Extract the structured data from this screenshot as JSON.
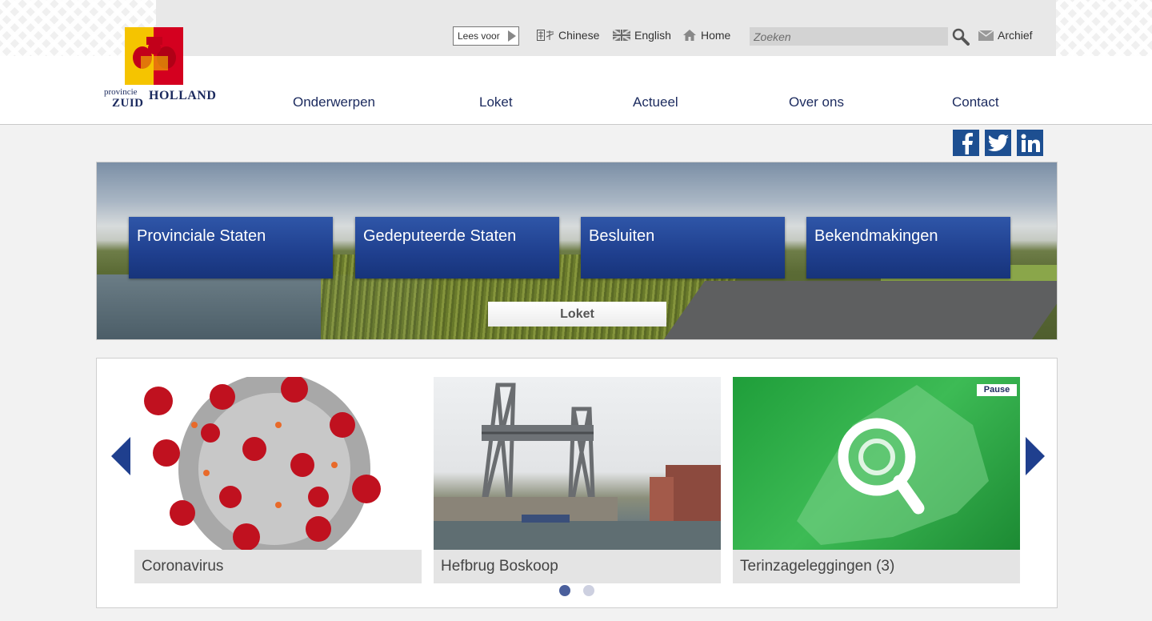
{
  "brand": {
    "line1": "provincie",
    "line2": "ZUID",
    "line3": "HOLLAND",
    "colors": {
      "navy": "#1b2a5e",
      "blue": "#1f3f8e",
      "yellow": "#f5c400",
      "red": "#d4001f"
    }
  },
  "topbar": {
    "lees_voor": "Lees voor",
    "links": [
      {
        "label": "Chinese",
        "icon": "chinese-icon"
      },
      {
        "label": "English",
        "icon": "uk-flag-icon"
      },
      {
        "label": "Home",
        "icon": "home-icon"
      }
    ],
    "search_placeholder": "Zoeken",
    "archive": "Archief"
  },
  "nav": [
    "Onderwerpen",
    "Loket",
    "Actueel",
    "Over ons",
    "Contact"
  ],
  "social": [
    "facebook-icon",
    "twitter-icon",
    "linkedin-icon"
  ],
  "hero": {
    "tiles": [
      "Provinciale Staten",
      "Gedeputeerde Staten",
      "Besluiten",
      "Bekendmakingen"
    ],
    "tab": "Loket"
  },
  "carousel": {
    "pause": "Pause",
    "cards": [
      "Coronavirus",
      "Hefbrug Boskoop",
      "Terinzageleggingen (3)"
    ],
    "dots": 2,
    "active_dot": 1
  }
}
